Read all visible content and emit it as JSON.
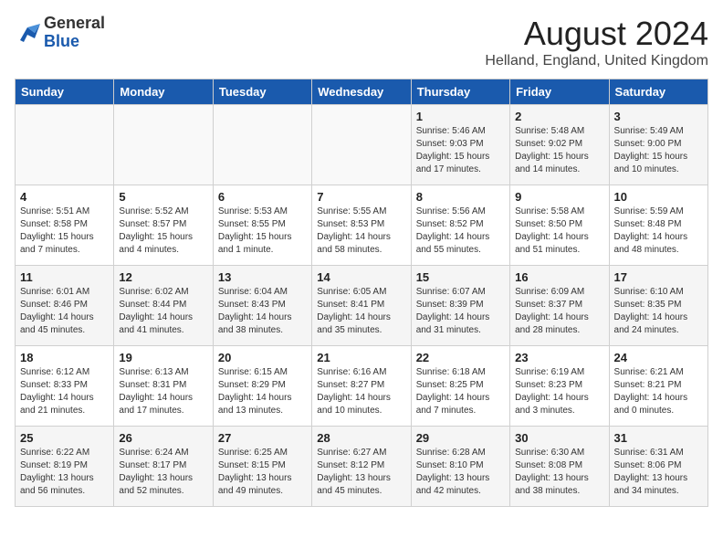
{
  "header": {
    "logo_general": "General",
    "logo_blue": "Blue",
    "month": "August 2024",
    "location": "Helland, England, United Kingdom"
  },
  "days_of_week": [
    "Sunday",
    "Monday",
    "Tuesday",
    "Wednesday",
    "Thursday",
    "Friday",
    "Saturday"
  ],
  "weeks": [
    [
      {
        "day": "",
        "info": ""
      },
      {
        "day": "",
        "info": ""
      },
      {
        "day": "",
        "info": ""
      },
      {
        "day": "",
        "info": ""
      },
      {
        "day": "1",
        "info": "Sunrise: 5:46 AM\nSunset: 9:03 PM\nDaylight: 15 hours\nand 17 minutes."
      },
      {
        "day": "2",
        "info": "Sunrise: 5:48 AM\nSunset: 9:02 PM\nDaylight: 15 hours\nand 14 minutes."
      },
      {
        "day": "3",
        "info": "Sunrise: 5:49 AM\nSunset: 9:00 PM\nDaylight: 15 hours\nand 10 minutes."
      }
    ],
    [
      {
        "day": "4",
        "info": "Sunrise: 5:51 AM\nSunset: 8:58 PM\nDaylight: 15 hours\nand 7 minutes."
      },
      {
        "day": "5",
        "info": "Sunrise: 5:52 AM\nSunset: 8:57 PM\nDaylight: 15 hours\nand 4 minutes."
      },
      {
        "day": "6",
        "info": "Sunrise: 5:53 AM\nSunset: 8:55 PM\nDaylight: 15 hours\nand 1 minute."
      },
      {
        "day": "7",
        "info": "Sunrise: 5:55 AM\nSunset: 8:53 PM\nDaylight: 14 hours\nand 58 minutes."
      },
      {
        "day": "8",
        "info": "Sunrise: 5:56 AM\nSunset: 8:52 PM\nDaylight: 14 hours\nand 55 minutes."
      },
      {
        "day": "9",
        "info": "Sunrise: 5:58 AM\nSunset: 8:50 PM\nDaylight: 14 hours\nand 51 minutes."
      },
      {
        "day": "10",
        "info": "Sunrise: 5:59 AM\nSunset: 8:48 PM\nDaylight: 14 hours\nand 48 minutes."
      }
    ],
    [
      {
        "day": "11",
        "info": "Sunrise: 6:01 AM\nSunset: 8:46 PM\nDaylight: 14 hours\nand 45 minutes."
      },
      {
        "day": "12",
        "info": "Sunrise: 6:02 AM\nSunset: 8:44 PM\nDaylight: 14 hours\nand 41 minutes."
      },
      {
        "day": "13",
        "info": "Sunrise: 6:04 AM\nSunset: 8:43 PM\nDaylight: 14 hours\nand 38 minutes."
      },
      {
        "day": "14",
        "info": "Sunrise: 6:05 AM\nSunset: 8:41 PM\nDaylight: 14 hours\nand 35 minutes."
      },
      {
        "day": "15",
        "info": "Sunrise: 6:07 AM\nSunset: 8:39 PM\nDaylight: 14 hours\nand 31 minutes."
      },
      {
        "day": "16",
        "info": "Sunrise: 6:09 AM\nSunset: 8:37 PM\nDaylight: 14 hours\nand 28 minutes."
      },
      {
        "day": "17",
        "info": "Sunrise: 6:10 AM\nSunset: 8:35 PM\nDaylight: 14 hours\nand 24 minutes."
      }
    ],
    [
      {
        "day": "18",
        "info": "Sunrise: 6:12 AM\nSunset: 8:33 PM\nDaylight: 14 hours\nand 21 minutes."
      },
      {
        "day": "19",
        "info": "Sunrise: 6:13 AM\nSunset: 8:31 PM\nDaylight: 14 hours\nand 17 minutes."
      },
      {
        "day": "20",
        "info": "Sunrise: 6:15 AM\nSunset: 8:29 PM\nDaylight: 14 hours\nand 13 minutes."
      },
      {
        "day": "21",
        "info": "Sunrise: 6:16 AM\nSunset: 8:27 PM\nDaylight: 14 hours\nand 10 minutes."
      },
      {
        "day": "22",
        "info": "Sunrise: 6:18 AM\nSunset: 8:25 PM\nDaylight: 14 hours\nand 7 minutes."
      },
      {
        "day": "23",
        "info": "Sunrise: 6:19 AM\nSunset: 8:23 PM\nDaylight: 14 hours\nand 3 minutes."
      },
      {
        "day": "24",
        "info": "Sunrise: 6:21 AM\nSunset: 8:21 PM\nDaylight: 14 hours\nand 0 minutes."
      }
    ],
    [
      {
        "day": "25",
        "info": "Sunrise: 6:22 AM\nSunset: 8:19 PM\nDaylight: 13 hours\nand 56 minutes."
      },
      {
        "day": "26",
        "info": "Sunrise: 6:24 AM\nSunset: 8:17 PM\nDaylight: 13 hours\nand 52 minutes."
      },
      {
        "day": "27",
        "info": "Sunrise: 6:25 AM\nSunset: 8:15 PM\nDaylight: 13 hours\nand 49 minutes."
      },
      {
        "day": "28",
        "info": "Sunrise: 6:27 AM\nSunset: 8:12 PM\nDaylight: 13 hours\nand 45 minutes."
      },
      {
        "day": "29",
        "info": "Sunrise: 6:28 AM\nSunset: 8:10 PM\nDaylight: 13 hours\nand 42 minutes."
      },
      {
        "day": "30",
        "info": "Sunrise: 6:30 AM\nSunset: 8:08 PM\nDaylight: 13 hours\nand 38 minutes."
      },
      {
        "day": "31",
        "info": "Sunrise: 6:31 AM\nSunset: 8:06 PM\nDaylight: 13 hours\nand 34 minutes."
      }
    ]
  ]
}
